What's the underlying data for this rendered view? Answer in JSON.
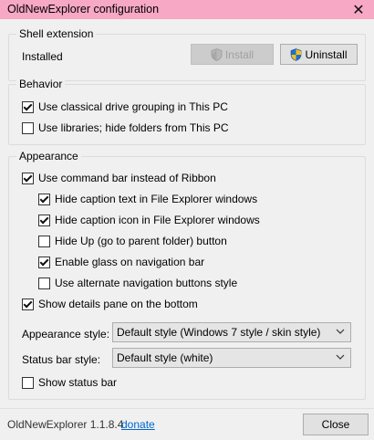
{
  "window": {
    "title": "OldNewExplorer configuration",
    "close_glyph": "✕"
  },
  "shell": {
    "legend": "Shell extension",
    "status": "Installed",
    "install_label": "Install",
    "uninstall_label": "Uninstall"
  },
  "behavior": {
    "legend": "Behavior",
    "options": [
      {
        "label": "Use classical drive grouping in This PC",
        "checked": true
      },
      {
        "label": "Use libraries; hide folders from This PC",
        "checked": false
      }
    ]
  },
  "appearance": {
    "legend": "Appearance",
    "command_bar": {
      "label": "Use command bar instead of Ribbon",
      "checked": true
    },
    "sub_options": [
      {
        "label": "Hide caption text in File Explorer windows",
        "checked": true
      },
      {
        "label": "Hide caption icon in File Explorer windows",
        "checked": true
      },
      {
        "label": "Hide Up (go to parent folder) button",
        "checked": false
      },
      {
        "label": "Enable glass on navigation bar",
        "checked": true
      },
      {
        "label": "Use alternate navigation buttons style",
        "checked": false
      }
    ],
    "details_pane": {
      "label": "Show details pane on the bottom",
      "checked": true
    },
    "appearance_style_label": "Appearance style:",
    "appearance_style_value": "Default style (Windows 7 style / skin style)",
    "status_bar_style_label": "Status bar style:",
    "status_bar_style_value": "Default style (white)",
    "show_status_bar": {
      "label": "Show status bar",
      "checked": false
    }
  },
  "footer": {
    "version": "OldNewExplorer 1.1.8.4",
    "donate": "donate",
    "close_label": "Close"
  },
  "colors": {
    "titlebar": "#f7a8c4",
    "client": "#f0f0f0",
    "link": "#0066cc",
    "focus": "#0078d7"
  }
}
